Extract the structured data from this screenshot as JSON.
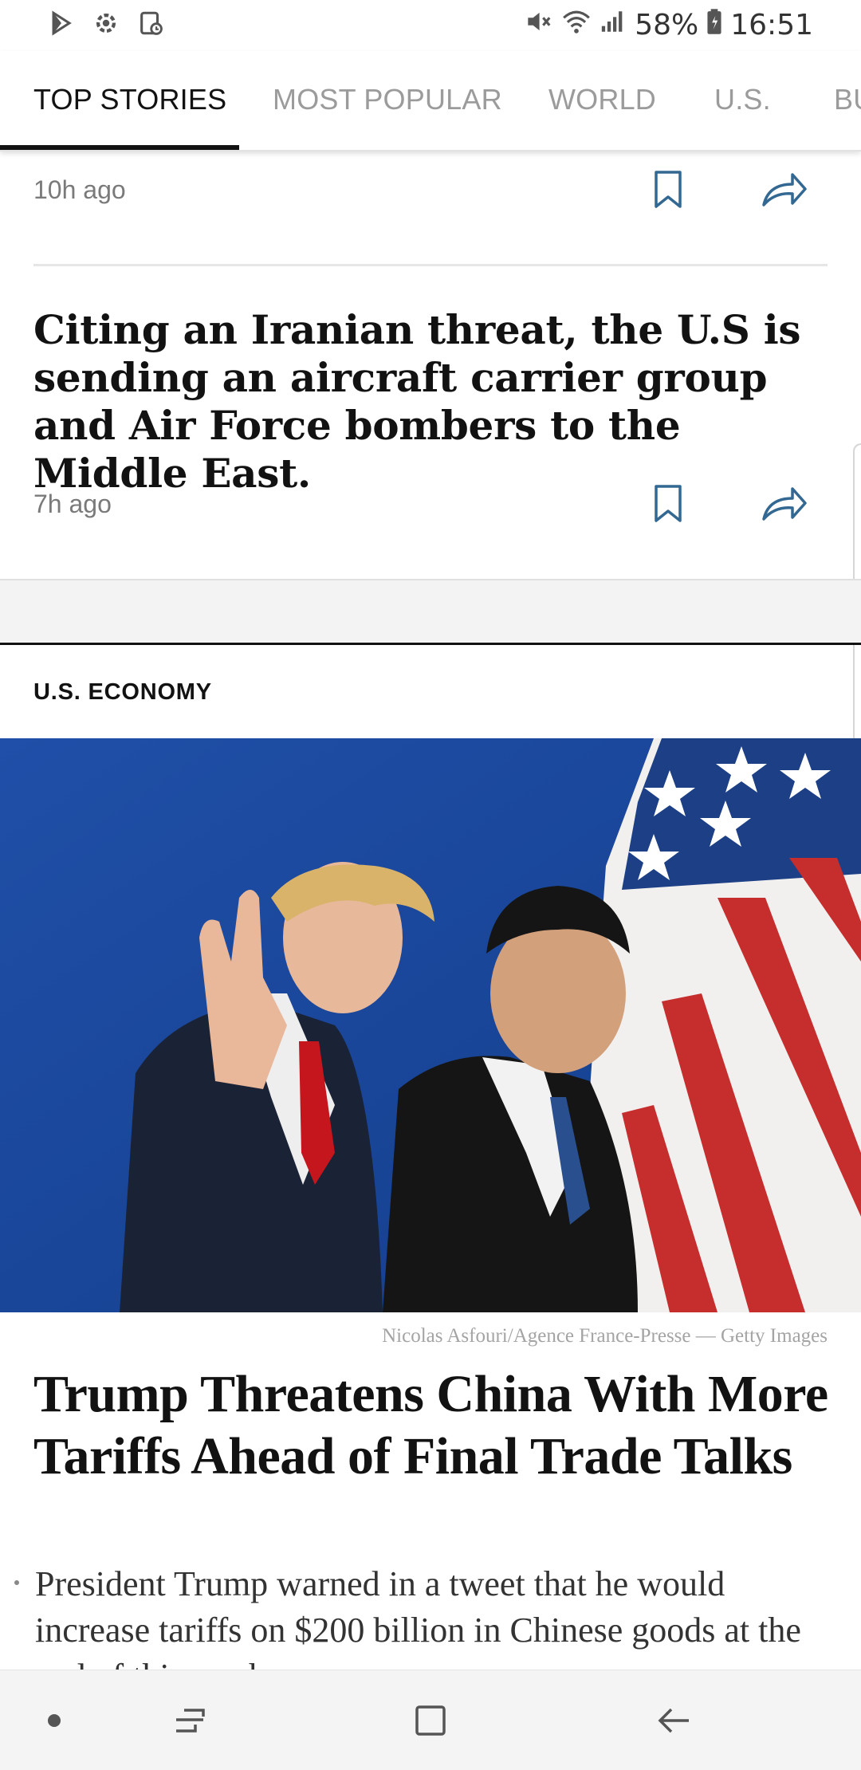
{
  "status_bar": {
    "left_icons": [
      "play-store-icon",
      "settings-gear-icon",
      "screenshot-icon"
    ],
    "right_icons": [
      "mute-icon",
      "wifi-icon",
      "signal-icon",
      "battery-icon"
    ],
    "battery": "58%",
    "time": "16:51"
  },
  "tabs": [
    {
      "label": "TOP STORIES",
      "active": true
    },
    {
      "label": "MOST POPULAR",
      "active": false
    },
    {
      "label": "WORLD",
      "active": false
    },
    {
      "label": "U.S.",
      "active": false
    },
    {
      "label": "BU",
      "active": false
    }
  ],
  "stories": [
    {
      "time": "10h ago"
    },
    {
      "headline": "Citing an Iranian threat, the U.S is sending an aircraft carrier group and Air Force bombers to the Middle East.",
      "time": "7h ago"
    }
  ],
  "featured": {
    "section": "U.S. ECONOMY",
    "photo_credit": "Nicolas Asfouri/Agence France-Presse — Getty Images",
    "headline": "Trump Threatens China With More Tariffs Ahead of Final Trade Talks",
    "summary": "President Trump warned in a tweet that he would increase tariffs on $200 billion in Chinese goods at the end of this week."
  },
  "nav_bar": {
    "icons": [
      "nav-dot-icon",
      "recent-apps-icon",
      "home-icon",
      "back-icon"
    ]
  },
  "colors": {
    "text": "#121212",
    "muted": "#9b9b9b",
    "accent_icon": "#326891"
  }
}
